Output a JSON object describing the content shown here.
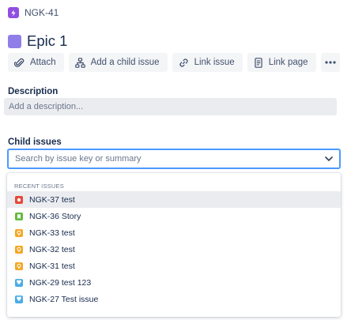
{
  "breadcrumb": {
    "issue_key": "NGK-41",
    "icon": "subtask-lightning-icon",
    "icon_color": "#904ee2"
  },
  "issue": {
    "title": "Epic 1",
    "icon": "epic-icon",
    "icon_color": "#8f7ee7"
  },
  "toolbar": {
    "attach_label": "Attach",
    "add_child_label": "Add a child issue",
    "link_issue_label": "Link issue",
    "link_page_label": "Link page",
    "more_icon": "more-icon"
  },
  "description": {
    "label": "Description",
    "placeholder": "Add a description..."
  },
  "child_issues": {
    "label": "Child issues",
    "search_placeholder": "Search by issue key or summary",
    "dropdown": {
      "header": "RECENT ISSUES",
      "items": [
        {
          "label": "NGK-37 test",
          "type": "bug",
          "color": "#e5493a",
          "selected": true
        },
        {
          "label": "NGK-36 Story",
          "type": "story",
          "color": "#63ba3c",
          "selected": false
        },
        {
          "label": "NGK-33 test",
          "type": "improvement",
          "color": "#f5a623",
          "selected": false
        },
        {
          "label": "NGK-32 test",
          "type": "improvement",
          "color": "#f5a623",
          "selected": false
        },
        {
          "label": "NGK-31 test",
          "type": "improvement",
          "color": "#f5a623",
          "selected": false
        },
        {
          "label": "NGK-29 test 123",
          "type": "feedback",
          "color": "#4bade8",
          "selected": false
        },
        {
          "label": "NGK-27 Test issue",
          "type": "feedback",
          "color": "#4bade8",
          "selected": false
        }
      ]
    }
  },
  "colors": {
    "focus_border": "#4c9aff",
    "text_primary": "#172b4d",
    "text_subtle": "#6b778c"
  }
}
